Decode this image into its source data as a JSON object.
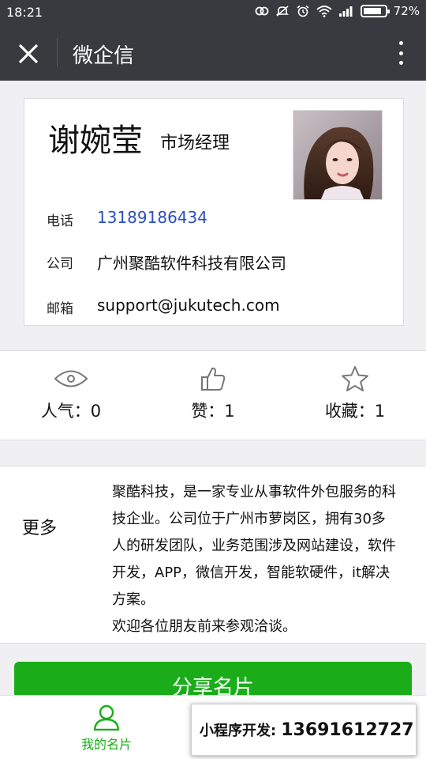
{
  "status_bar": {
    "time": "18:21",
    "battery": "72%"
  },
  "nav": {
    "title": "微企信"
  },
  "card": {
    "name": "谢婉莹",
    "title": "市场经理",
    "phone_label": "电话",
    "phone": "13189186434",
    "company_label": "公司",
    "company": "广州聚酷软件科技有限公司",
    "email_label": "邮箱",
    "email": "support@jukutech.com"
  },
  "stats": {
    "popularity": "人气：0",
    "likes": "赞：1",
    "favorites": "收藏：1"
  },
  "more": {
    "label": "更多",
    "lines": [
      "聚酷科技，是一家专业从事软件外包服务的科",
      "技企业。公司位于广州市萝岗区，拥有30多",
      "人的研发团队，业务范围涉及网站建设，软件",
      "开发，APP，微信开发，智能软硬件，it解决",
      "方案。",
      "欢迎各位朋友前来参观洽谈。"
    ]
  },
  "share_button": "分享名片",
  "tabbar": {
    "my_card": "我的名片"
  },
  "promo": {
    "label": "小程序开发:",
    "phone": "13691612727"
  },
  "colors": {
    "header": "#393a3f",
    "accent": "#1aad19",
    "link": "#2b4ec2"
  }
}
